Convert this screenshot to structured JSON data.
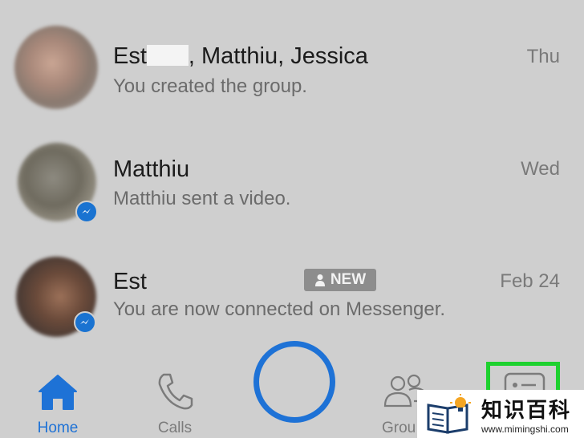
{
  "conversations": [
    {
      "name_part1": "Est",
      "name_part2": ", Matthiu, Jessica",
      "preview": "You created the group.",
      "time": "Thu",
      "badge": null
    },
    {
      "name": "Matthiu",
      "preview": "Matthiu sent a video.",
      "time": "Wed",
      "badge": "messenger-badge"
    },
    {
      "name": "Est",
      "new_label": "NEW",
      "preview": "You are now connected on Messenger.",
      "time": "Feb 24",
      "badge": "messenger-badge"
    }
  ],
  "tabbar": {
    "home": "Home",
    "calls": "Calls",
    "groups": "Grou",
    "active_color": "#1e72d6",
    "inactive_color": "#7b7b7b"
  },
  "highlight_color": "#1ed12f",
  "watermark": {
    "title": "知识百科",
    "url": "www.mimingshi.com"
  }
}
